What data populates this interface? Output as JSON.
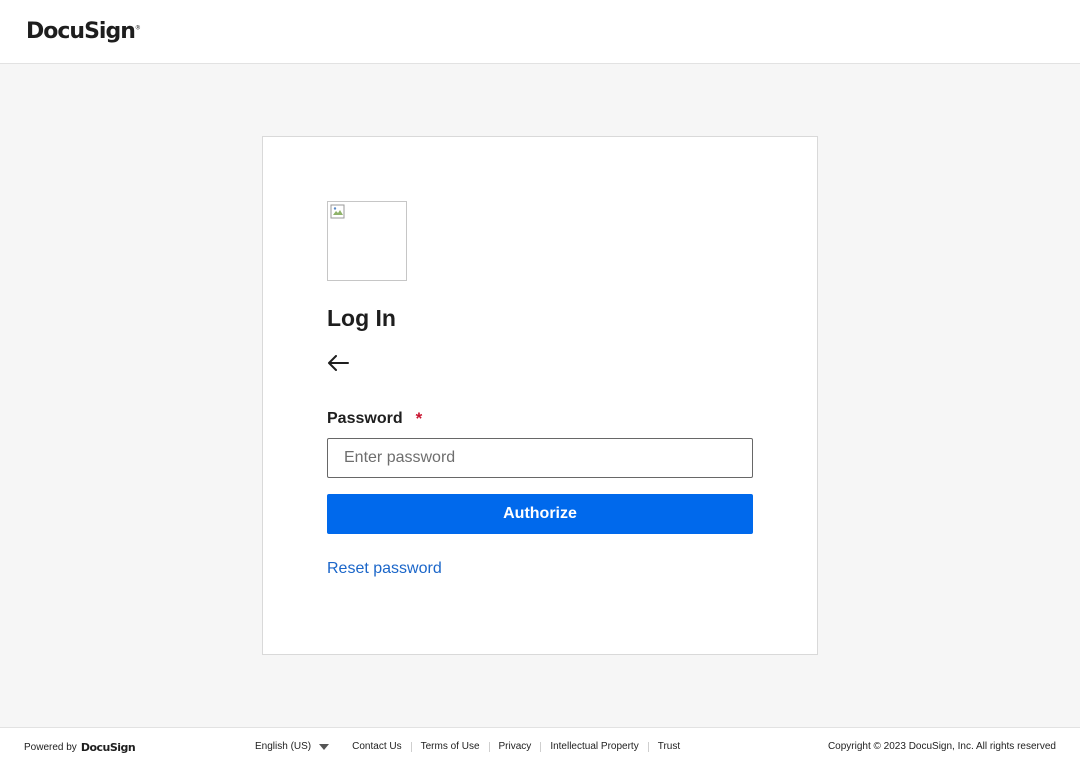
{
  "header": {
    "brand": "DocuSign",
    "trademark": "®"
  },
  "login": {
    "title": "Log In",
    "password_label": "Password",
    "required_marker": "*",
    "password_placeholder": "Enter password",
    "authorize_label": "Authorize",
    "reset_label": "Reset password"
  },
  "footer": {
    "powered_by": "Powered by",
    "powered_brand": "DocuSign",
    "language": "English (US)",
    "links": [
      "Contact Us",
      "Terms of Use",
      "Privacy",
      "Intellectual Property",
      "Trust"
    ],
    "copyright": "Copyright © 2023 DocuSign, Inc. All rights reserved"
  },
  "colors": {
    "primary": "#0069ec",
    "link": "#1b66c9",
    "required": "#c9132f",
    "background": "#f6f6f6"
  },
  "icons": [
    "back-arrow-icon",
    "broken-image-icon",
    "chevron-down-icon"
  ]
}
